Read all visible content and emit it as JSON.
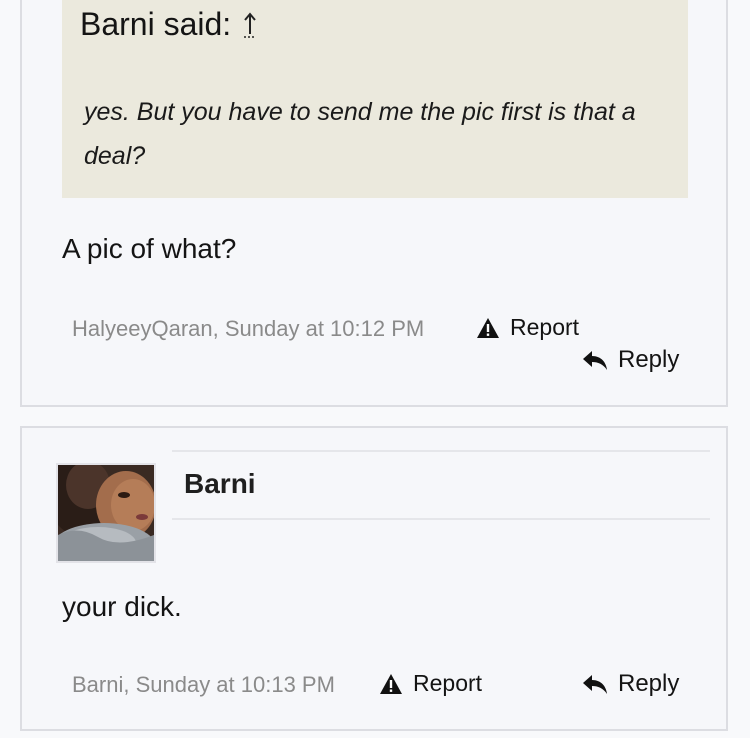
{
  "posts": [
    {
      "quote": {
        "author_label": "Barni said:",
        "jump_icon": "arrow-up-jump-icon",
        "text": "yes. But you have to send me the pic first is that a deal?"
      },
      "message": "A pic of what?",
      "footer": {
        "info": "HalyeeyQaran, Sunday at 10:12 PM",
        "report_label": "Report",
        "reply_label": "Reply"
      }
    },
    {
      "author": {
        "name": "Barni"
      },
      "message": "your dick.",
      "footer": {
        "info": "Barni, Sunday at 10:13 PM",
        "report_label": "Report",
        "reply_label": "Reply"
      }
    }
  ],
  "colors": {
    "quote_bg": "#ebe9dd",
    "post_bg": "#f6f7fa",
    "border": "#dcdde2",
    "meta_text": "#8a8a8a"
  }
}
